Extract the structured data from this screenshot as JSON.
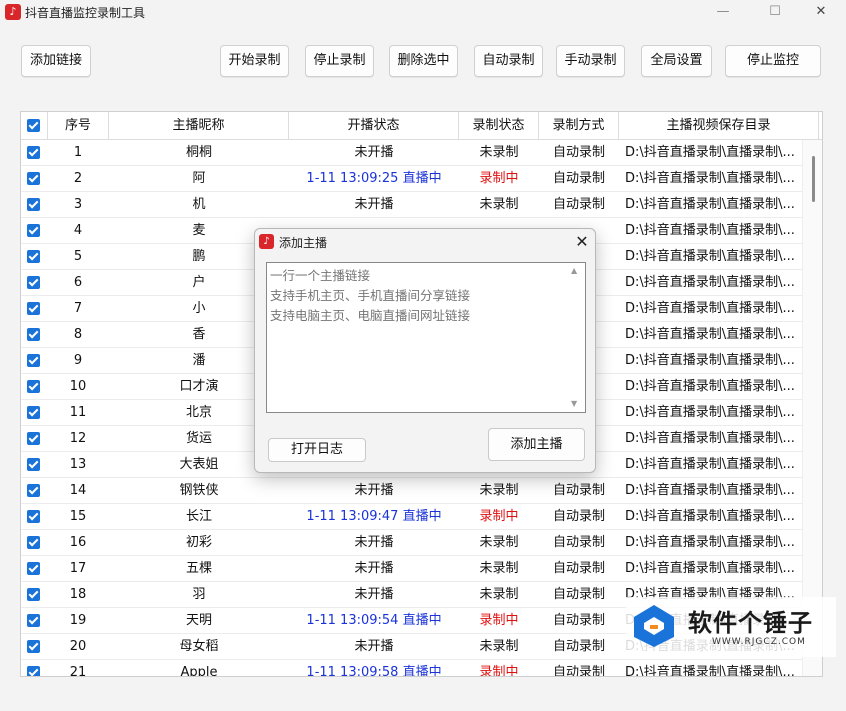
{
  "window": {
    "title": "抖音直播监控录制工具",
    "logo_glyph": "♪",
    "min_glyph": "—",
    "max_glyph": "☐",
    "close_glyph": "✕"
  },
  "toolbar": {
    "add_link": "添加链接",
    "start_record": "开始录制",
    "stop_record": "停止录制",
    "delete_selected": "删除选中",
    "auto_record": "自动录制",
    "manual_record": "手动录制",
    "global_settings": "全局设置",
    "stop_monitor": "停止监控"
  },
  "table": {
    "headers": {
      "num": "序号",
      "name": "主播昵称",
      "live": "开播状态",
      "rec": "录制状态",
      "mode": "录制方式",
      "dir": "主播视频保存目录"
    },
    "rows": [
      {
        "num": "1",
        "name": "桐桐",
        "live": "未开播",
        "live_color": "",
        "rec": "未录制",
        "rec_color": "",
        "mode": "自动录制",
        "dir": "D:\\抖音直播录制\\直播录制\\..."
      },
      {
        "num": "2",
        "name": "阿",
        "live": "1-11 13:09:25 直播中",
        "live_color": "blue",
        "rec": "录制中",
        "rec_color": "red",
        "mode": "自动录制",
        "dir": "D:\\抖音直播录制\\直播录制\\..."
      },
      {
        "num": "3",
        "name": "机",
        "live": "未开播",
        "live_color": "",
        "rec": "未录制",
        "rec_color": "",
        "mode": "自动录制",
        "dir": "D:\\抖音直播录制\\直播录制\\..."
      },
      {
        "num": "4",
        "name": "麦",
        "live": "",
        "live_color": "",
        "rec": "",
        "rec_color": "",
        "mode": "",
        "dir": "D:\\抖音直播录制\\直播录制\\..."
      },
      {
        "num": "5",
        "name": "鹏",
        "live": "",
        "live_color": "",
        "rec": "",
        "rec_color": "",
        "mode": "",
        "dir": "D:\\抖音直播录制\\直播录制\\..."
      },
      {
        "num": "6",
        "name": "户",
        "live": "",
        "live_color": "",
        "rec": "",
        "rec_color": "",
        "mode": "",
        "dir": "D:\\抖音直播录制\\直播录制\\..."
      },
      {
        "num": "7",
        "name": "小",
        "live": "",
        "live_color": "",
        "rec": "",
        "rec_color": "",
        "mode": "",
        "dir": "D:\\抖音直播录制\\直播录制\\..."
      },
      {
        "num": "8",
        "name": "香",
        "live": "",
        "live_color": "",
        "rec": "",
        "rec_color": "",
        "mode": "",
        "dir": "D:\\抖音直播录制\\直播录制\\..."
      },
      {
        "num": "9",
        "name": "潘",
        "live": "",
        "live_color": "",
        "rec": "",
        "rec_color": "",
        "mode": "",
        "dir": "D:\\抖音直播录制\\直播录制\\..."
      },
      {
        "num": "10",
        "name": "口才演",
        "live": "",
        "live_color": "",
        "rec": "",
        "rec_color": "",
        "mode": "",
        "dir": "D:\\抖音直播录制\\直播录制\\..."
      },
      {
        "num": "11",
        "name": "北京",
        "live": "",
        "live_color": "",
        "rec": "",
        "rec_color": "",
        "mode": "",
        "dir": "D:\\抖音直播录制\\直播录制\\..."
      },
      {
        "num": "12",
        "name": "货运",
        "live": "",
        "live_color": "",
        "rec": "",
        "rec_color": "",
        "mode": "",
        "dir": "D:\\抖音直播录制\\直播录制\\..."
      },
      {
        "num": "13",
        "name": "大表姐",
        "live": "",
        "live_color": "",
        "rec": "",
        "rec_color": "",
        "mode": "",
        "dir": "D:\\抖音直播录制\\直播录制\\..."
      },
      {
        "num": "14",
        "name": "钢铁侠",
        "live": "未开播",
        "live_color": "",
        "rec": "未录制",
        "rec_color": "",
        "mode": "自动录制",
        "dir": "D:\\抖音直播录制\\直播录制\\..."
      },
      {
        "num": "15",
        "name": "长江",
        "live": "1-11 13:09:47 直播中",
        "live_color": "blue",
        "rec": "录制中",
        "rec_color": "red",
        "mode": "自动录制",
        "dir": "D:\\抖音直播录制\\直播录制\\..."
      },
      {
        "num": "16",
        "name": "初彩",
        "live": "未开播",
        "live_color": "",
        "rec": "未录制",
        "rec_color": "",
        "mode": "自动录制",
        "dir": "D:\\抖音直播录制\\直播录制\\..."
      },
      {
        "num": "17",
        "name": "五棵",
        "live": "未开播",
        "live_color": "",
        "rec": "未录制",
        "rec_color": "",
        "mode": "自动录制",
        "dir": "D:\\抖音直播录制\\直播录制\\..."
      },
      {
        "num": "18",
        "name": "羽",
        "live": "未开播",
        "live_color": "",
        "rec": "未录制",
        "rec_color": "",
        "mode": "自动录制",
        "dir": "D:\\抖音直播录制\\直播录制\\..."
      },
      {
        "num": "19",
        "name": "天明",
        "live": "1-11 13:09:54 直播中",
        "live_color": "blue",
        "rec": "录制中",
        "rec_color": "red",
        "mode": "自动录制",
        "dir": "D:\\抖音直播录制\\直播录制\\..."
      },
      {
        "num": "20",
        "name": "母女稻",
        "live": "未开播",
        "live_color": "",
        "rec": "未录制",
        "rec_color": "",
        "mode": "自动录制",
        "dir": "D:\\抖音直播录制\\直播录制\\..."
      },
      {
        "num": "21",
        "name": "Apple",
        "live": "1-11 13:09:58 直播中",
        "live_color": "blue",
        "rec": "录制中",
        "rec_color": "red",
        "mode": "自动录制",
        "dir": "D:\\抖音直播录制\\直播录制\\..."
      }
    ]
  },
  "dialog": {
    "title": "添加主播",
    "placeholder": "一行一个主播链接\n支持手机主页、手机直播间分享链接\n支持电脑主页、电脑直播间网址链接",
    "open_log": "打开日志",
    "add_anchor": "添加主播",
    "close_glyph": "✕",
    "scroll_up_glyph": "▲",
    "scroll_down_glyph": "▼"
  },
  "watermark": {
    "text": "软件个锤子",
    "sub": "WWW.RJGCZ.COM"
  },
  "colors": {
    "accent": "#1a73d9",
    "live_blue": "#1a33d9",
    "record_red": "#e01010",
    "logo_red": "#d8262b"
  }
}
